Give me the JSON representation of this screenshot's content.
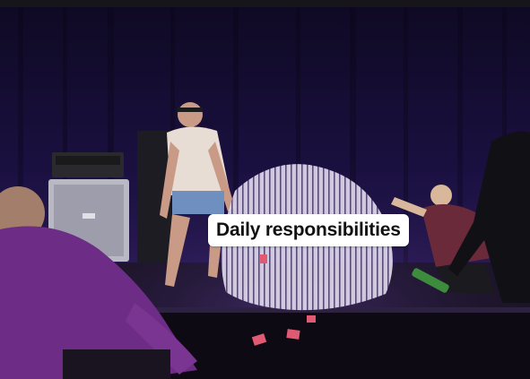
{
  "caption": {
    "text": "Daily responsibilities"
  },
  "palette": {
    "curtain": "#150d33",
    "stage_light": "#6b3fb0",
    "floor": "#1b1424",
    "caption_bg": "#ffffff",
    "caption_text": "#111111"
  }
}
